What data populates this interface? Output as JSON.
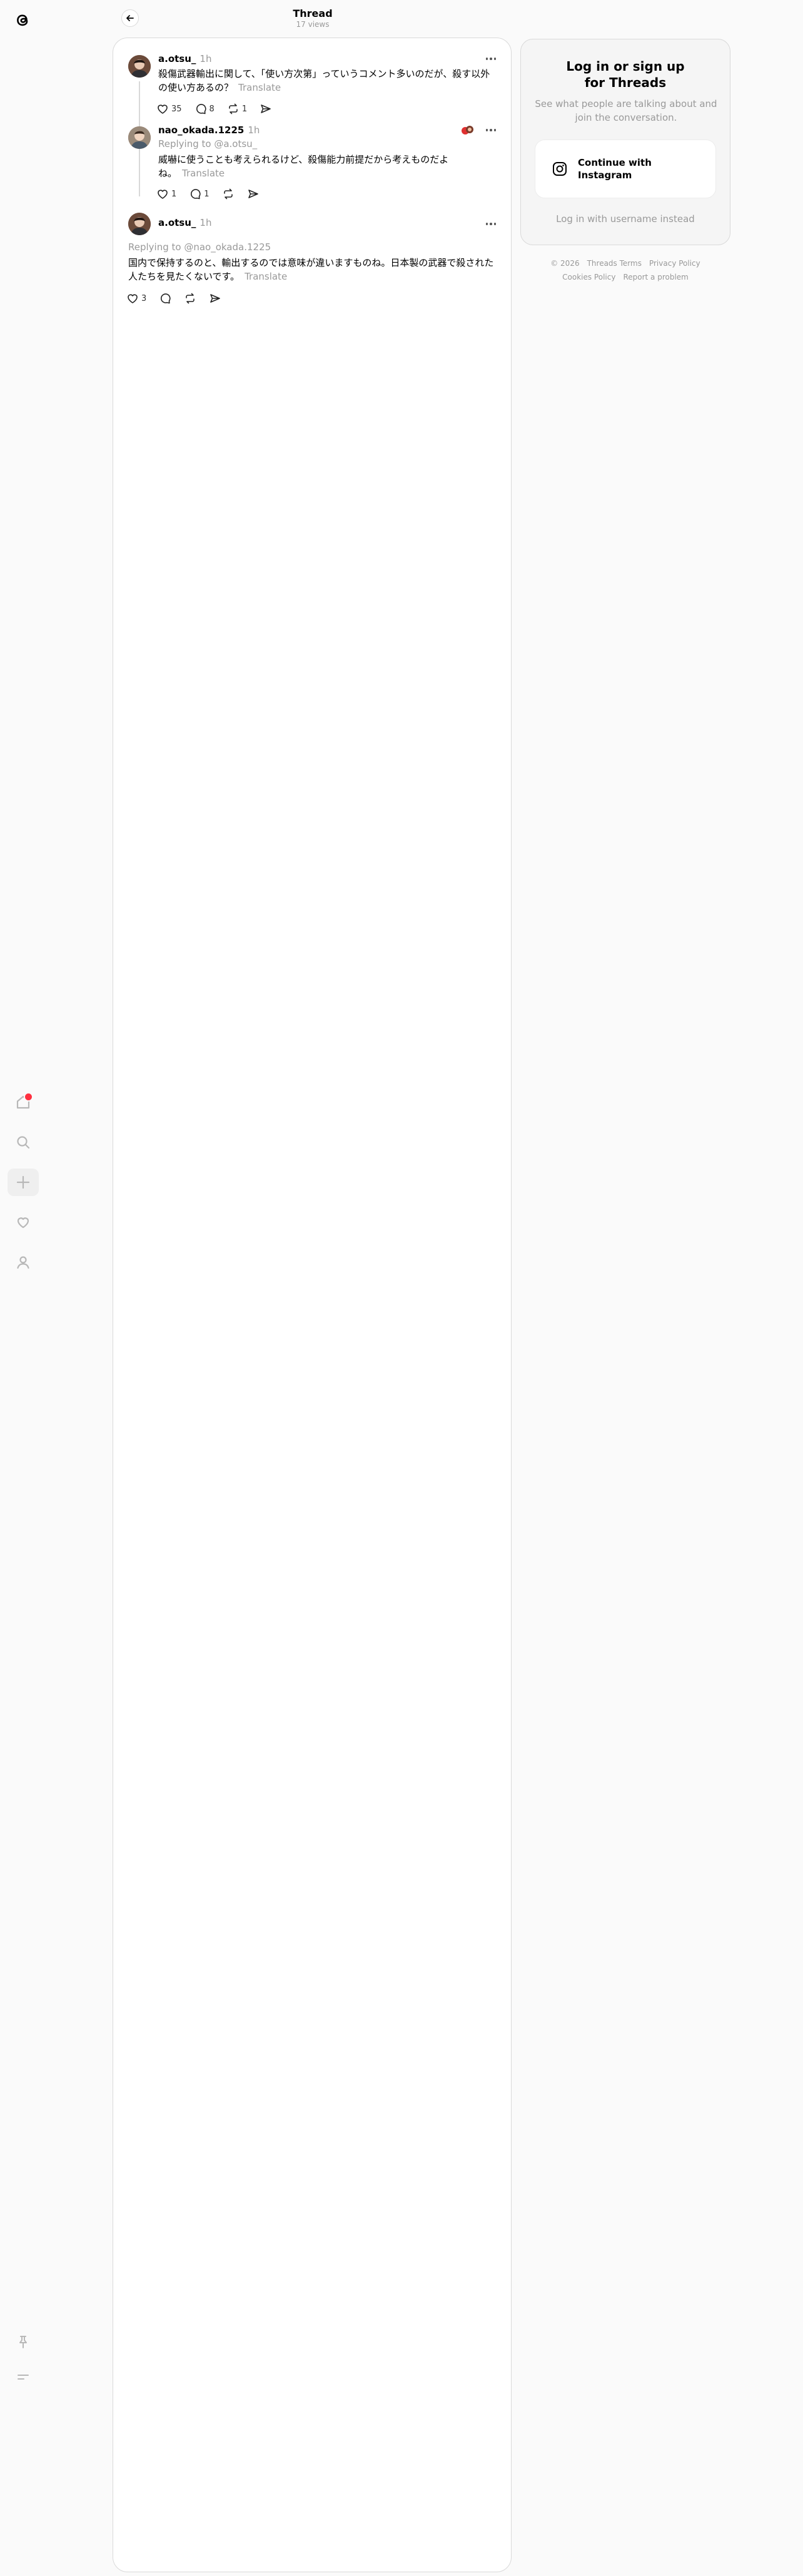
{
  "header": {
    "title": "Thread",
    "views": "17 views"
  },
  "posts": [
    {
      "username": "a.otsu_",
      "time": "1h",
      "text": "殺傷武器輸出に関して、「使い方次第」っていうコメント多いのだが、殺す以外の使い方あるの？",
      "translate": "Translate",
      "likes": "35",
      "replies": "8",
      "reposts": "1"
    },
    {
      "username": "nao_okada.1225",
      "time": "1h",
      "replying": "Replying to @a.otsu_",
      "text": "威嚇に使うことも考えられるけど、殺傷能力前提だから考えものだよね。",
      "translate": "Translate",
      "likes": "1",
      "replies": "1",
      "reposts": ""
    },
    {
      "username": "a.otsu_",
      "time": "1h",
      "replying": "Replying to @nao_okada.1225",
      "text": "国内で保持するのと、輸出するのでは意味が違いますものね。日本製の武器で殺された人たちを見たくないです。",
      "translate": "Translate",
      "likes": "3",
      "replies": "",
      "reposts": ""
    }
  ],
  "login": {
    "title": "Log in or sign up for Threads",
    "subtitle": "See what people are talking about and join the conversation.",
    "instagram_button": "Continue with Instagram",
    "alt": "Log in with username instead"
  },
  "footer": {
    "copyright": "© 2026",
    "terms": "Threads Terms",
    "privacy": "Privacy Policy",
    "cookies": "Cookies Policy",
    "report": "Report a problem"
  },
  "colors": {
    "notification_badge": "#ff3040",
    "text_muted": "#999999",
    "border": "#d9d9d9"
  }
}
